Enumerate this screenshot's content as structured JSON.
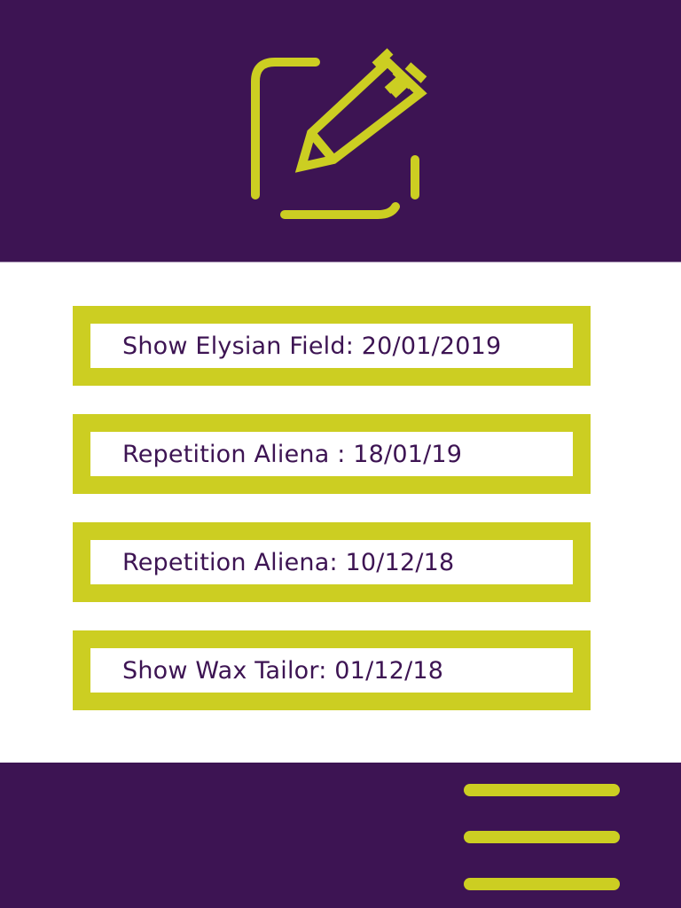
{
  "colors": {
    "primary": "#3d1453",
    "accent": "#ccce22",
    "background": "#ffffff"
  },
  "header": {
    "icon": "edit-icon"
  },
  "entries": [
    {
      "label": "Show Elysian Field: 20/01/2019"
    },
    {
      "label": "Repetition Aliena : 18/01/19"
    },
    {
      "label": "Repetition Aliena: 10/12/18"
    },
    {
      "label": "Show Wax Tailor: 01/12/18"
    }
  ],
  "footer": {
    "menu_icon": "hamburger-menu-icon"
  }
}
